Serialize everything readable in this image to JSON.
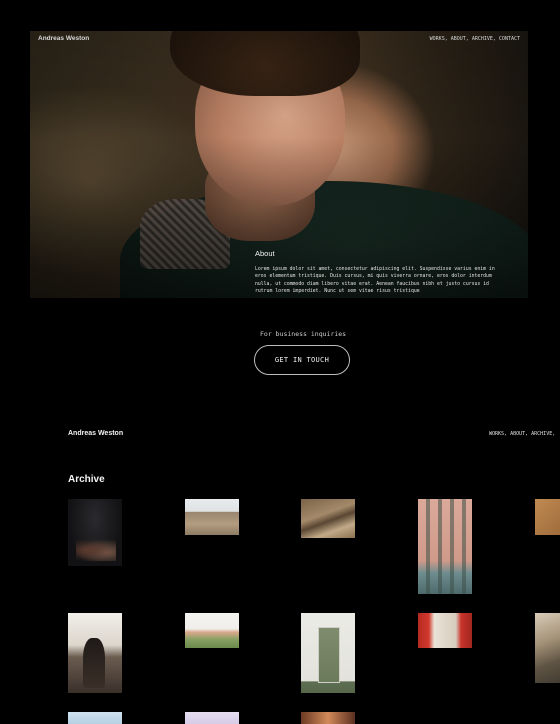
{
  "hero": {
    "brand": "Andreas Weston",
    "nav": [
      "WORKS,",
      "ABOUT,",
      "ARCHIVE,",
      "CONTACT"
    ],
    "about_title": "About",
    "about_text": "Lorem ipsum dolor sit amet, consectetur adipiscing elit. Suspendisse varius enim in eros elementum tristique. Duis cursus, mi quis viverra ornare, eros dolor interdum nulla, ut commodo diam libero vitae erat. Aenean faucibus nibh et justo cursus id rutrum lorem imperdiet. Nunc ut sem vitae risus tristique"
  },
  "inquiries": {
    "label": "For business inquiries",
    "cta": "GET IN TOUCH"
  },
  "archive_section": {
    "brand": "Andreas Weston",
    "nav": "WORKS, ABOUT, ARCHIVE,",
    "title": "Archive"
  }
}
